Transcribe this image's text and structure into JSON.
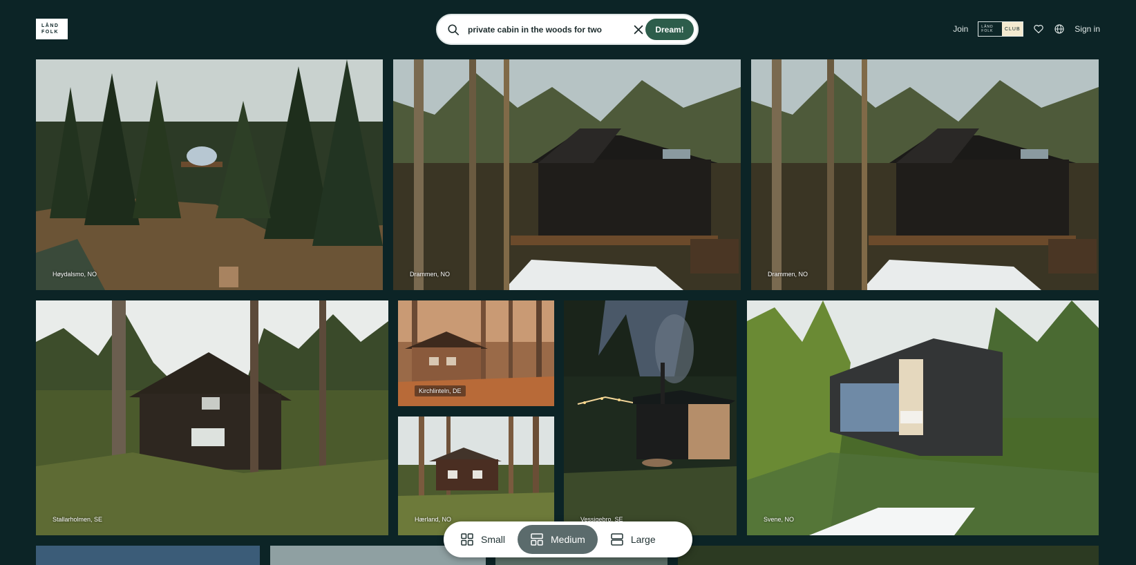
{
  "brand": {
    "logo_line1": "LÅND",
    "logo_line2": "FOLK"
  },
  "search": {
    "query": "private cabin in the woods for two",
    "submit_label": "Dream!"
  },
  "nav": {
    "join_label": "Join",
    "club_line1": "LÅND",
    "club_line2": "FOLK",
    "club_label": "CLUB",
    "signin_label": "Sign in"
  },
  "listings": [
    {
      "location": "Høydalsmo, NO"
    },
    {
      "location": "Drammen, NO"
    },
    {
      "location": "Drammen, NO"
    },
    {
      "location": "Stallarholmen, SE"
    },
    {
      "location": "Kirchlinteln, DE"
    },
    {
      "location": "Hærland, NO"
    },
    {
      "location": "Vessigebro, SE"
    },
    {
      "location": "Svene, NO"
    }
  ],
  "size_toggle": {
    "options": [
      {
        "label": "Small"
      },
      {
        "label": "Medium"
      },
      {
        "label": "Large"
      }
    ],
    "selected": "Medium"
  },
  "colors": {
    "background": "#0c2426",
    "accent": "#2d5d4b",
    "toggle_active": "#5b6b6c"
  }
}
